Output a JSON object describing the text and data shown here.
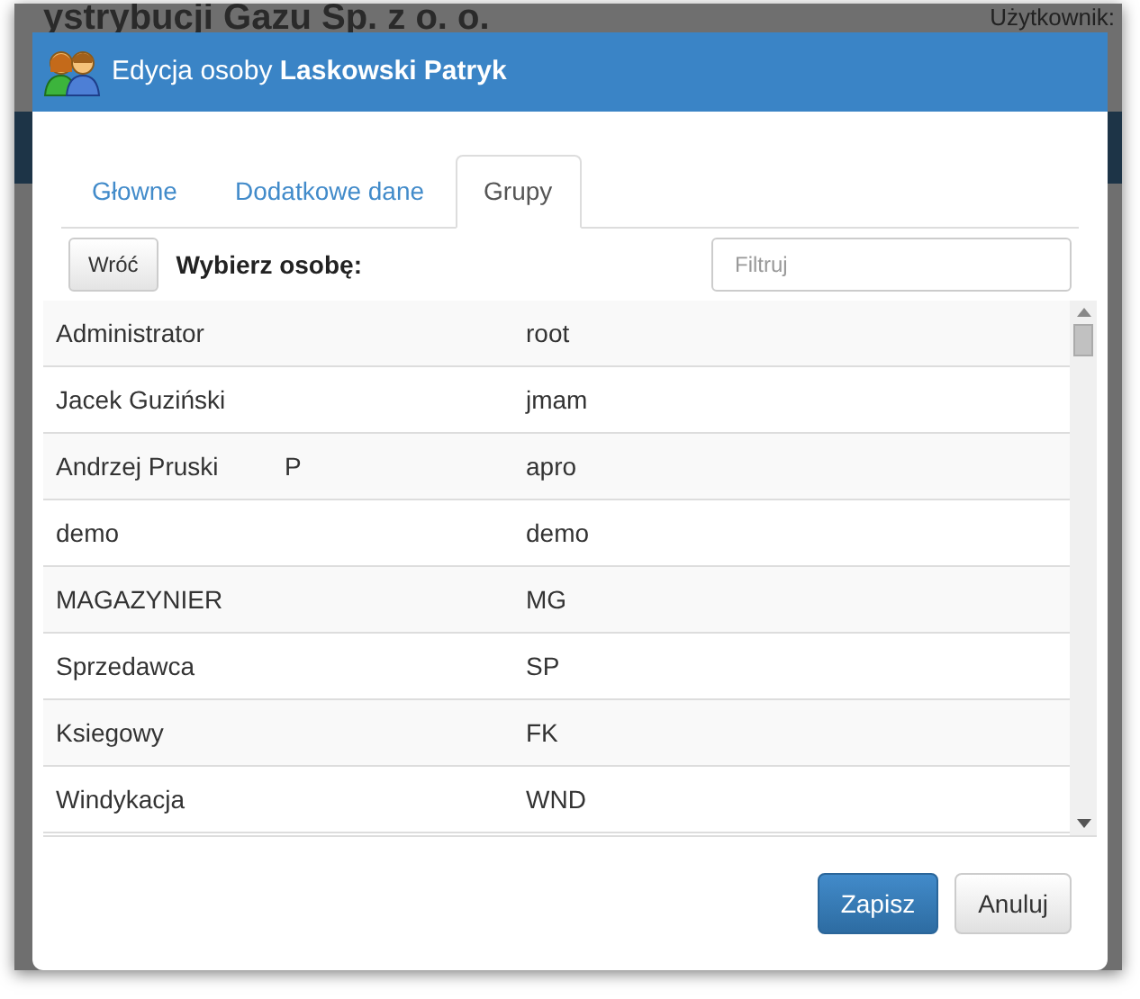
{
  "background_page": {
    "company_title": "ystrybucji Gazu Sp. z o. o.",
    "user_label": "Użytkownik:"
  },
  "dialog": {
    "title": "Edycja osoby **Laskowski Patryk**",
    "tabs": [
      {
        "label": "Głowne",
        "selected": false
      },
      {
        "label": "Dodatkowe dane",
        "selected": false
      },
      {
        "label": "Grupy",
        "selected": true
      }
    ],
    "back_button": "Wróć",
    "prompt": "Wybierz osobę:",
    "filter": {
      "placeholder": "Filtruj"
    },
    "rows": [
      {
        "column_1": "Administrator",
        "column_3": "root"
      },
      {
        "column_1": "Jacek Guziński",
        "column_3": "jmam"
      },
      {
        "column_1": "Andrzej Pruski",
        "column_2": "P",
        "column_3": "apro"
      },
      {
        "column_1": "demo",
        "column_3": "demo"
      },
      {
        "column_1": "MAGAZYNIER",
        "column_3": "MG"
      },
      {
        "column_1": "Sprzedawca",
        "column_3": "SP"
      },
      {
        "column_1": "Ksiegowy",
        "column_3": "FK"
      },
      {
        "column_1": "Windykacja",
        "column_3": "WND"
      }
    ],
    "buttons": [
      {
        "label": "Zapisz",
        "kind": "primary"
      },
      {
        "label": "Anuluj",
        "kind": "default"
      }
    ]
  }
}
